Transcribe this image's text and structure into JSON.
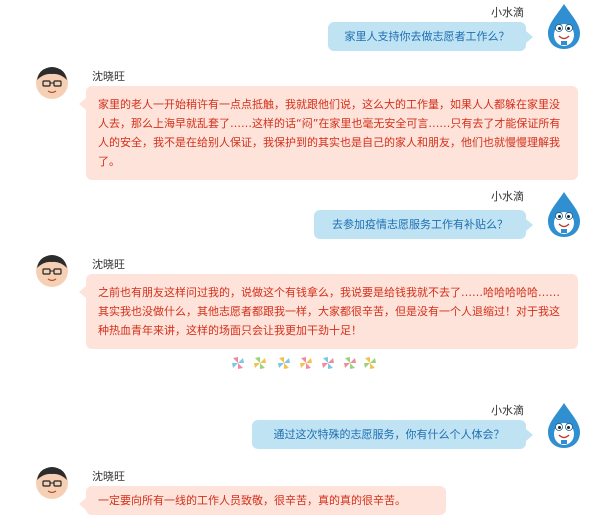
{
  "speakers": {
    "reporter": "小水滴",
    "volunteer": "沈晓旺"
  },
  "messages": [
    {
      "from": "reporter",
      "text": "家里人支持你去做志愿者工作么？"
    },
    {
      "from": "volunteer",
      "text": "家里的老人一开始稍许有一点点抵触，我就跟他们说，这么大的工作量，如果人人都躲在家里没人去，那么上海早就乱套了……这样的话“闷”在家里也毫无安全可言……只有去了才能保证所有人的安全，我不是在给别人保证，我保护到的其实也是自己的家人和朋友，他们也就慢慢理解我了。"
    },
    {
      "from": "reporter",
      "text": "去参加疫情志愿服务工作有补贴么？"
    },
    {
      "from": "volunteer",
      "text": "之前也有朋友这样问过我的，说做这个有钱拿么，我说要是给钱我就不去了……哈哈哈哈哈……其实我也没做什么，其他志愿者都跟我一样，大家都很辛苦，但是没有一个人退缩过！对于我这种热血青年来讲，这样的场面只会让我更加干劲十足！"
    },
    {
      "from": "reporter",
      "text": "通过这次特殊的志愿服务，你有什么个人体会？"
    },
    {
      "from": "volunteer",
      "text": "一定要向所有一线的工作人员致敬，很辛苦，真的真的很辛苦。"
    }
  ],
  "colors": {
    "reporter_bubble": "#bfe3f3",
    "reporter_text": "#1f6fb2",
    "volunteer_bubble": "#fde3d9",
    "volunteer_text": "#d4301c"
  },
  "icons": {
    "reporter_avatar": "water-drop-mascot-icon",
    "volunteer_avatar": "person-glasses-avatar-icon",
    "divider": "pinwheel-divider"
  }
}
